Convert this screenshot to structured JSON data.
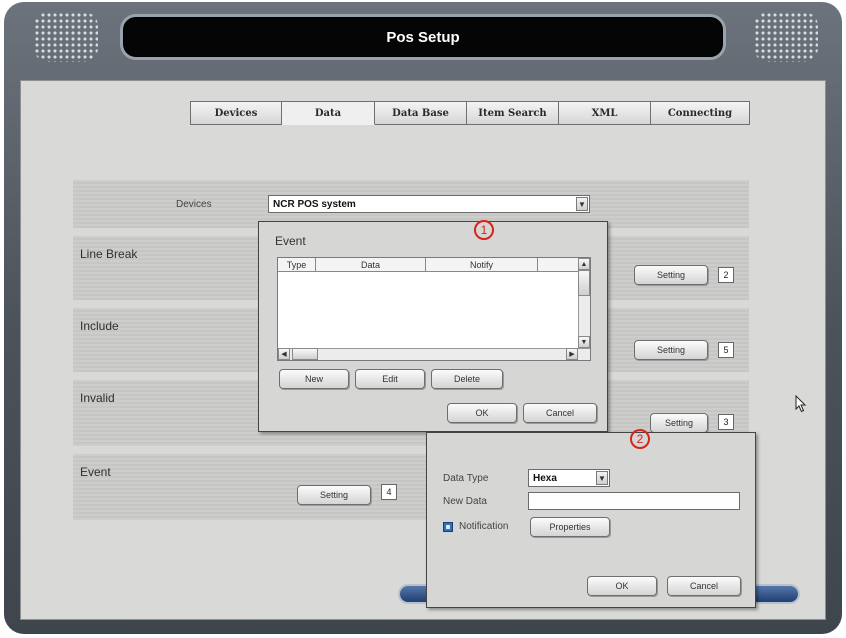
{
  "window": {
    "title": "Pos Setup"
  },
  "tabs": [
    {
      "label": "Devices"
    },
    {
      "label": "Data"
    },
    {
      "label": "Data Base"
    },
    {
      "label": "Item Search"
    },
    {
      "label": "XML"
    },
    {
      "label": "Connecting"
    }
  ],
  "active_tab": "Data",
  "devices_row": {
    "label": "Devices",
    "selected": "NCR POS system"
  },
  "sections": {
    "line_break": {
      "title": "Line Break",
      "setting_label": "Setting",
      "count": "2"
    },
    "include": {
      "title": "Include",
      "setting_label": "Setting",
      "count": "5"
    },
    "invalid": {
      "title": "Invalid",
      "setting_label": "Setting",
      "count": "3"
    },
    "event": {
      "title": "Event",
      "setting_label": "Setting",
      "count": "4"
    }
  },
  "event_dialog": {
    "title": "Event",
    "columns": [
      "Type",
      "Data",
      "Notify"
    ],
    "new_label": "New",
    "edit_label": "Edit",
    "delete_label": "Delete",
    "ok_label": "OK",
    "cancel_label": "Cancel",
    "marker": "1"
  },
  "data_dialog": {
    "data_type_label": "Data Type",
    "data_type_value": "Hexa",
    "new_data_label": "New Data",
    "new_data_value": "",
    "notification_label": "Notification",
    "properties_label": "Properties",
    "ok_label": "OK",
    "cancel_label": "Cancel",
    "marker": "2"
  },
  "colors": {
    "frame": "#4c535b",
    "title_bar": "#050505",
    "content_bg": "#d9d9d7",
    "annotation": "#d8221c",
    "checkbox": "#2f6fc0"
  }
}
